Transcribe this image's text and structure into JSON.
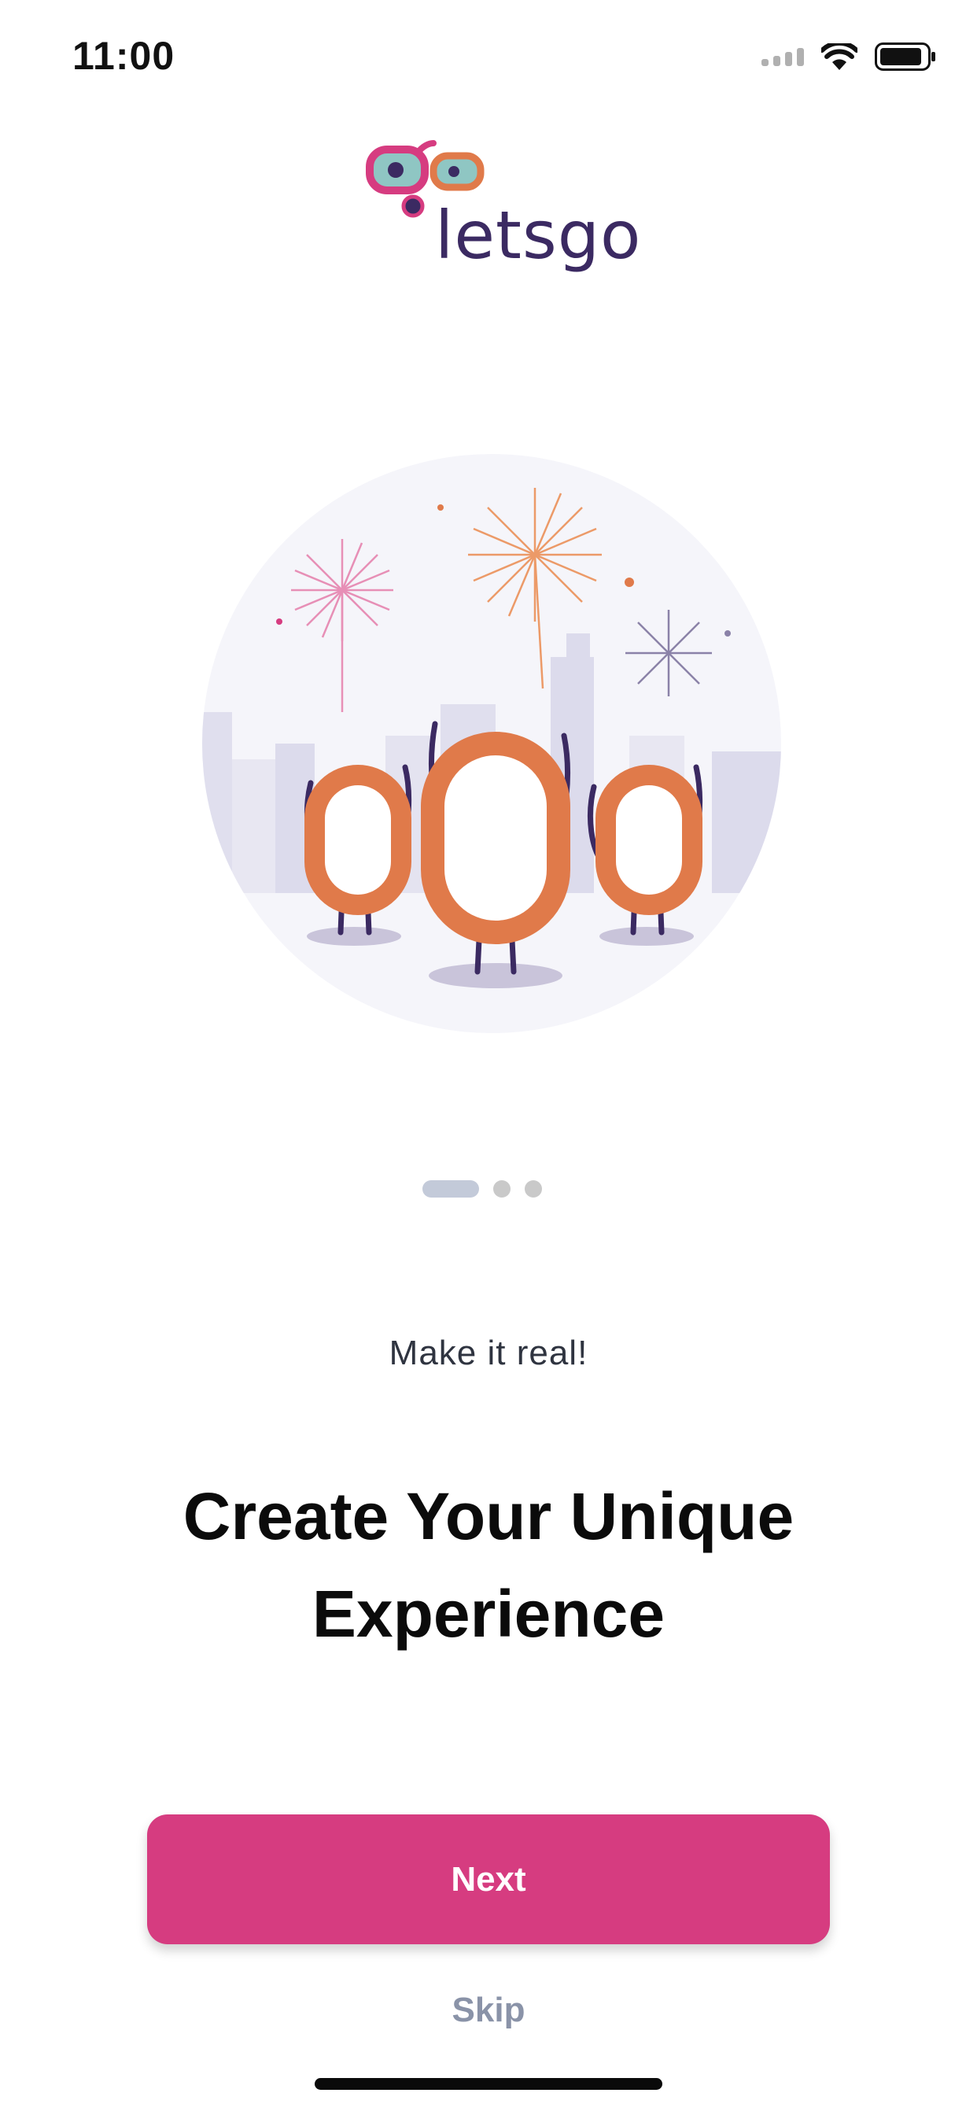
{
  "status_bar": {
    "time": "11:00",
    "icons": [
      "signal-icon",
      "wifi-icon",
      "battery-icon"
    ]
  },
  "brand": {
    "name": "letsgo",
    "colors": {
      "pink": "#d63c80",
      "teal": "#8fc6c3",
      "orange": "#e07a4a",
      "purple": "#3b2a62"
    }
  },
  "onboarding": {
    "illustration": "celebrating-characters-fireworks",
    "page_indicator": {
      "current": 1,
      "total": 3
    },
    "subtitle": "Make it real!",
    "title": "Create Your Unique Experience",
    "next_label": "Next",
    "skip_label": "Skip"
  },
  "colors": {
    "accent": "#d63c80",
    "skip": "#8a93a8",
    "pager_active": "#c3cad9",
    "pager_inactive": "#c9c9c9"
  }
}
